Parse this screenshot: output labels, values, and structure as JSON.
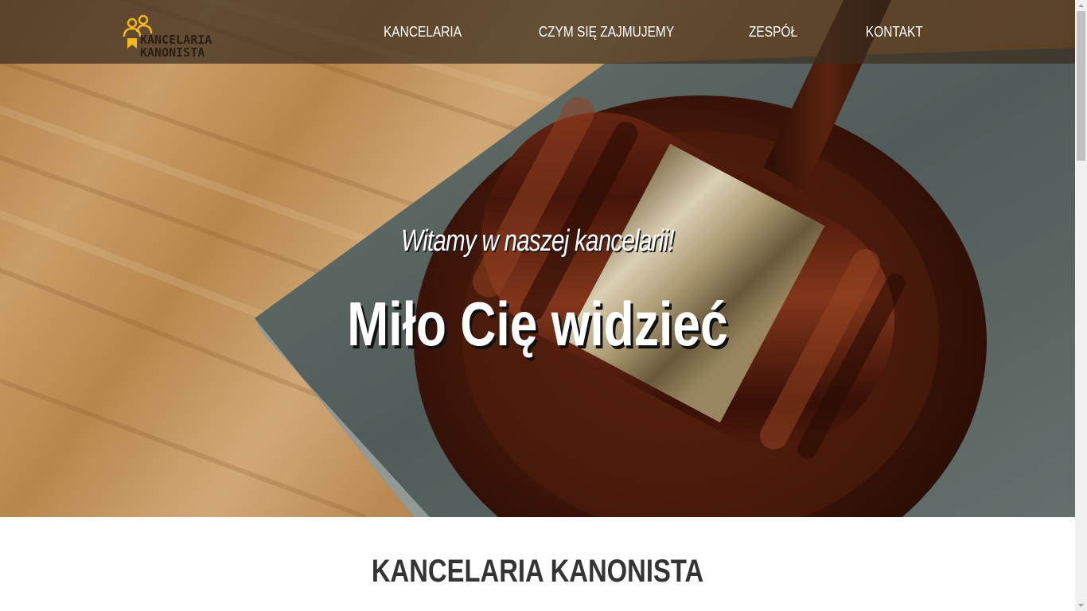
{
  "logo": {
    "line1": "KANCELARIA",
    "line2": "KANONISTA",
    "icon": "people-award-icon",
    "accent_color": "#f5b81c"
  },
  "nav": {
    "items": [
      {
        "label": "KANCELARIA"
      },
      {
        "label": "CZYM SIĘ ZAJMUJEMY"
      },
      {
        "label": "ZESPÓŁ"
      },
      {
        "label": "KONTAKT"
      }
    ]
  },
  "hero": {
    "subtitle": "Witamy w naszej kancelarii!",
    "title": "Miło Cię widzieć",
    "image": "gavel-on-book-photo"
  },
  "section": {
    "title": "KANCELARIA KANONISTA"
  },
  "colors": {
    "navbar_bg": "#3a2c1e",
    "heading": "#343434",
    "wood": "#c99656",
    "book": "#5b6966"
  }
}
